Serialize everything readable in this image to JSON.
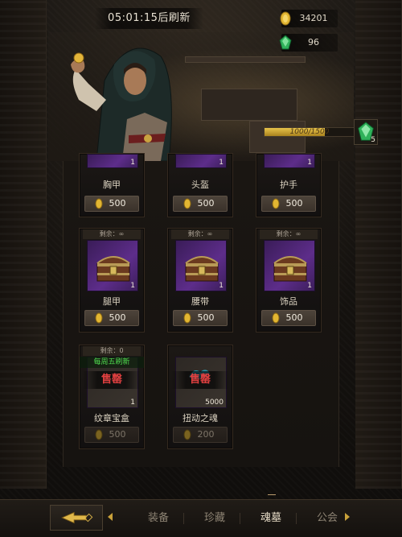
{
  "header": {
    "refresh_timer": "05:01:15后刷新",
    "gold_amount": "34201",
    "gem_amount": "96"
  },
  "hero": {
    "progress_text": "1000/1500",
    "progress_fraction": 0.667,
    "reward_count": "5"
  },
  "shop": {
    "items": [
      {
        "name": "胸甲",
        "qty": "1",
        "price": "500",
        "remain": "",
        "sold_out": false
      },
      {
        "name": "头盔",
        "qty": "1",
        "price": "500",
        "remain": "",
        "sold_out": false
      },
      {
        "name": "护手",
        "qty": "1",
        "price": "500",
        "remain": "",
        "sold_out": false
      },
      {
        "name": "腿甲",
        "qty": "1",
        "price": "500",
        "remain": "剩余：∞",
        "sold_out": false
      },
      {
        "name": "腰带",
        "qty": "1",
        "price": "500",
        "remain": "剩余：∞",
        "sold_out": false
      },
      {
        "name": "饰品",
        "qty": "1",
        "price": "500",
        "remain": "剩余：∞",
        "sold_out": false
      },
      {
        "name": "纹章宝盒",
        "qty": "1",
        "price": "500",
        "remain": "剩余：0",
        "sold_out": true,
        "tag": "每周五刷新",
        "sold_label": "售罄"
      },
      {
        "name": "扭动之魂",
        "qty": "5000",
        "price": "200",
        "remain": "",
        "sold_out": true,
        "sold_label": "售罄"
      }
    ]
  },
  "nav": {
    "tabs": [
      {
        "label": "装备"
      },
      {
        "label": "珍藏"
      },
      {
        "label": "魂墓"
      },
      {
        "label": "公会"
      }
    ],
    "active_tab": "魂墓"
  },
  "colors": {
    "accent_gold": "#e8c34a",
    "slot_purple": "#5d2d8a",
    "sold_red": "#e04040",
    "weekly_green": "#4fdc4f"
  },
  "icons": [
    "gold-coin-icon",
    "green-gem-icon",
    "chest-icon",
    "back-arrow-icon",
    "chevron-left-icon",
    "chevron-right-icon"
  ]
}
